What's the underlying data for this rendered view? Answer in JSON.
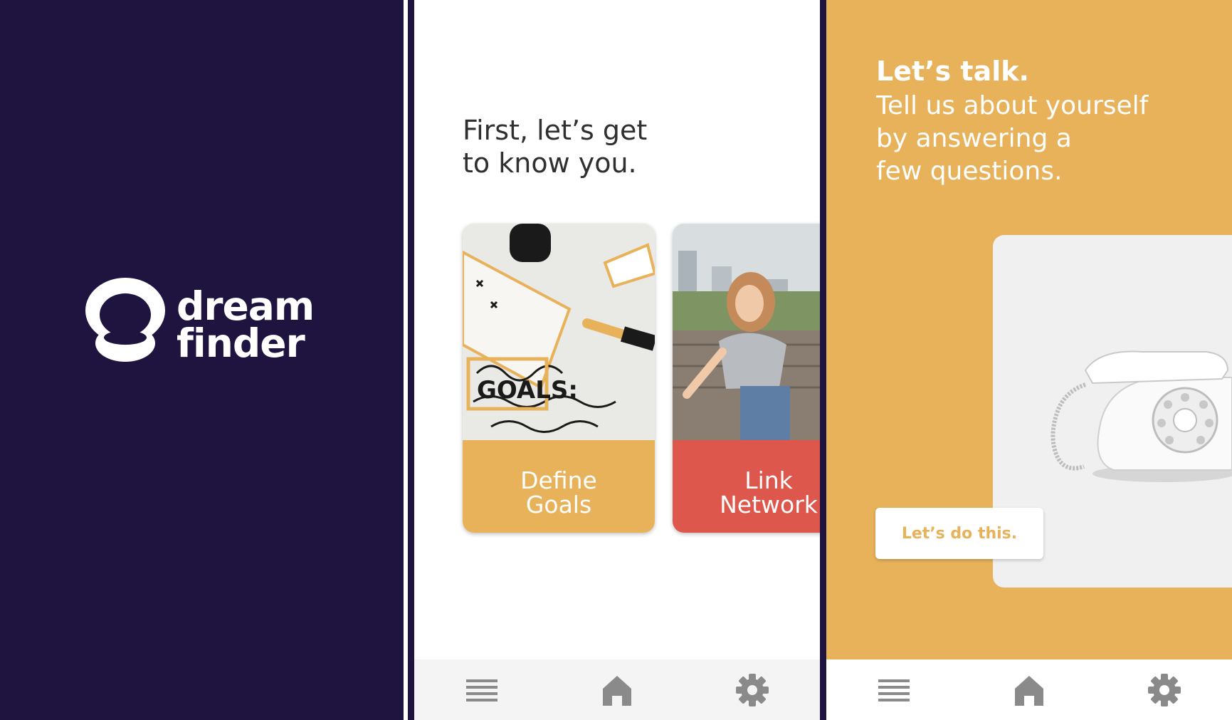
{
  "splash": {
    "logo_line1": "dream",
    "logo_line2": "finder",
    "background": "#1f1340"
  },
  "onboarding": {
    "heading": "First, let’s get\nto know you.",
    "cards": [
      {
        "label": "Define\nGoals",
        "color": "#e8b25a",
        "image": "notebook-goals-photo"
      },
      {
        "label": "Link\nNetwork",
        "color": "#dd574c",
        "image": "laughing-woman-photo"
      }
    ]
  },
  "talk": {
    "title": "Let’s talk.",
    "subtitle": "Tell us about yourself\nby answering a\nfew questions.",
    "cta_label": "Let’s do this.",
    "background": "#e8b25a",
    "image": "rotary-telephone-photo"
  },
  "nav": {
    "icons": [
      "menu-icon",
      "home-icon",
      "settings-icon"
    ],
    "icon_color": "#8a8a8a"
  }
}
